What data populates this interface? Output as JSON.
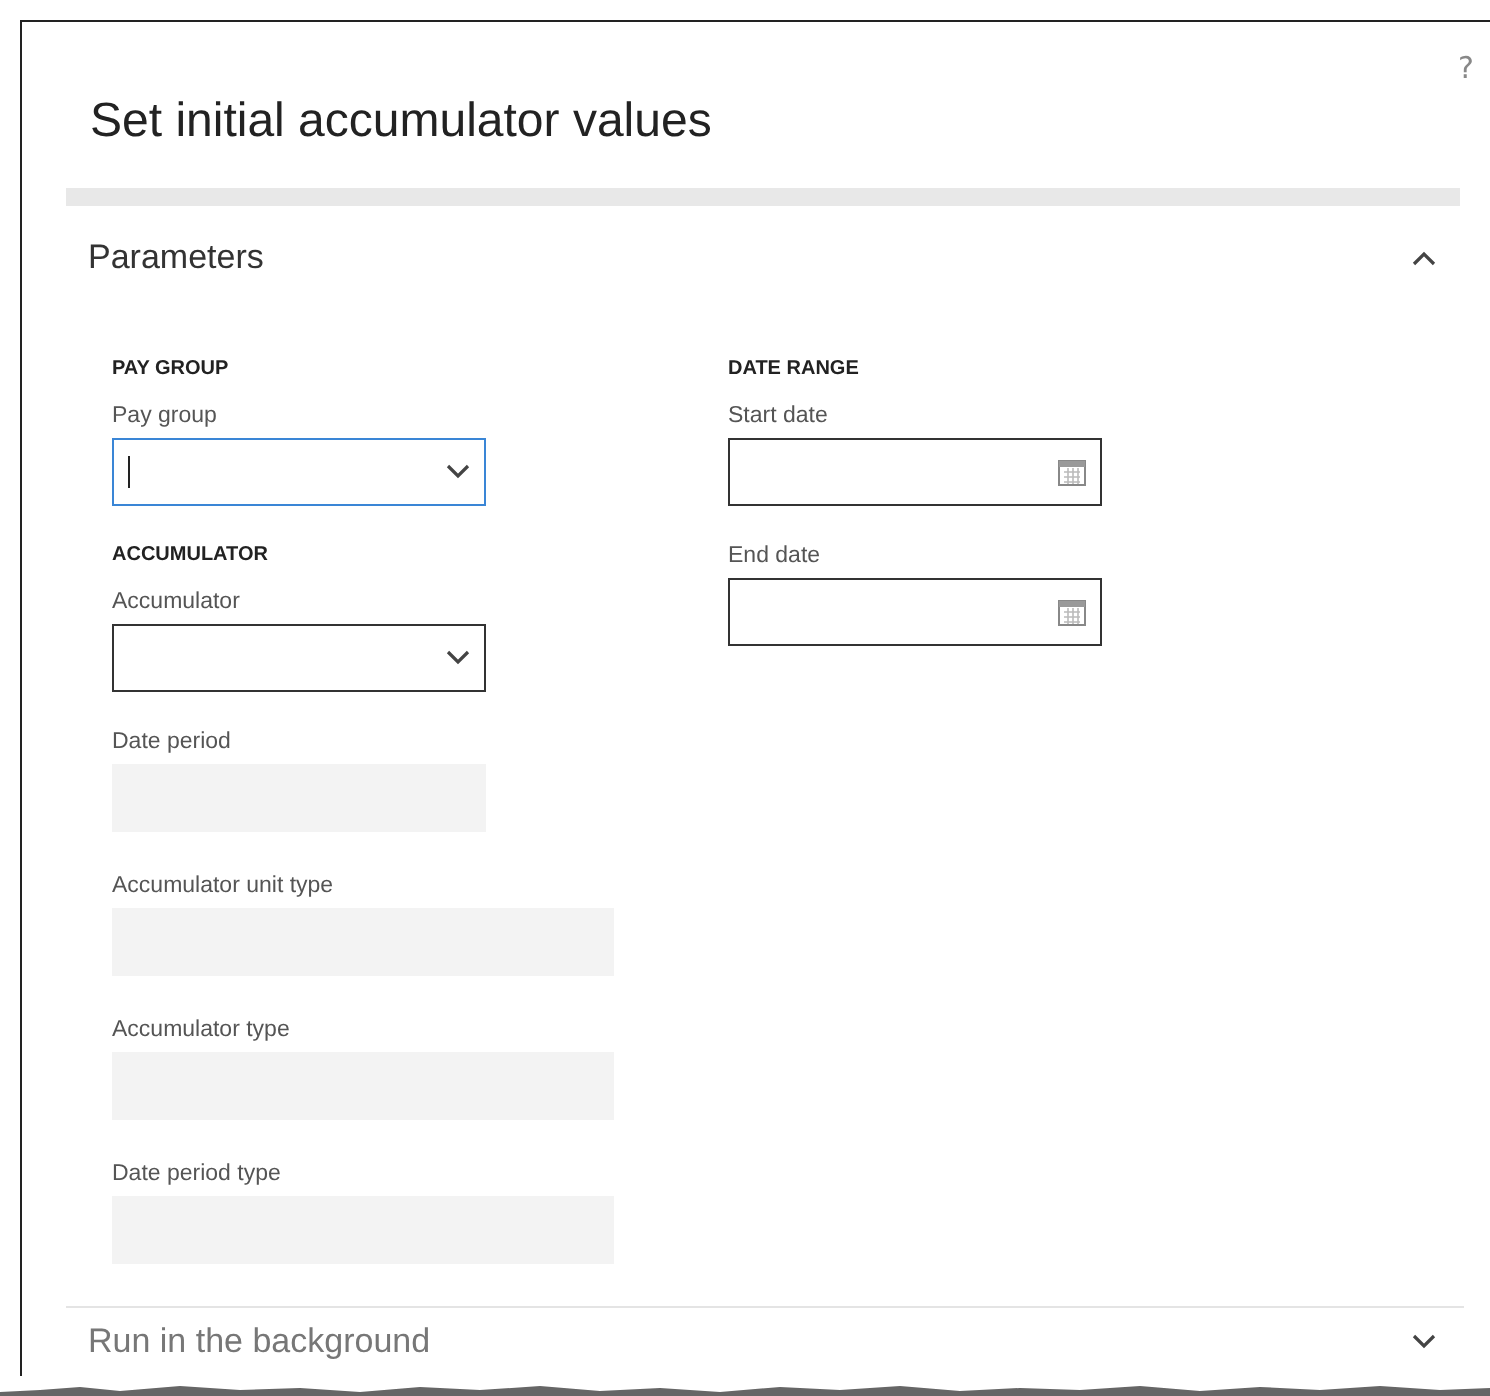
{
  "dialog": {
    "title": "Set initial accumulator values",
    "help": "?"
  },
  "sections": [
    {
      "title": "Parameters",
      "expanded": true,
      "columns": [
        [
          {
            "heading": "PAY GROUP",
            "fields": [
              {
                "label": "Pay group",
                "kind": "dropdown",
                "focused": true
              }
            ]
          },
          {
            "heading": "ACCUMULATOR",
            "fields": [
              {
                "label": "Accumulator",
                "kind": "dropdown",
                "focused": false
              },
              {
                "label": "Date period",
                "kind": "readonly",
                "focused": false
              },
              {
                "label": "Accumulator unit type",
                "kind": "readonly-wide",
                "focused": false
              },
              {
                "label": "Accumulator type",
                "kind": "readonly-wide",
                "focused": false
              },
              {
                "label": "Date period type",
                "kind": "readonly-wide",
                "focused": false
              }
            ]
          }
        ],
        [
          {
            "heading": "DATE RANGE",
            "fields": [
              {
                "label": "Start date",
                "kind": "date",
                "focused": false
              },
              {
                "label": "End date",
                "kind": "date",
                "focused": false
              }
            ]
          }
        ]
      ]
    },
    {
      "title": "Run in the background",
      "expanded": false
    }
  ]
}
